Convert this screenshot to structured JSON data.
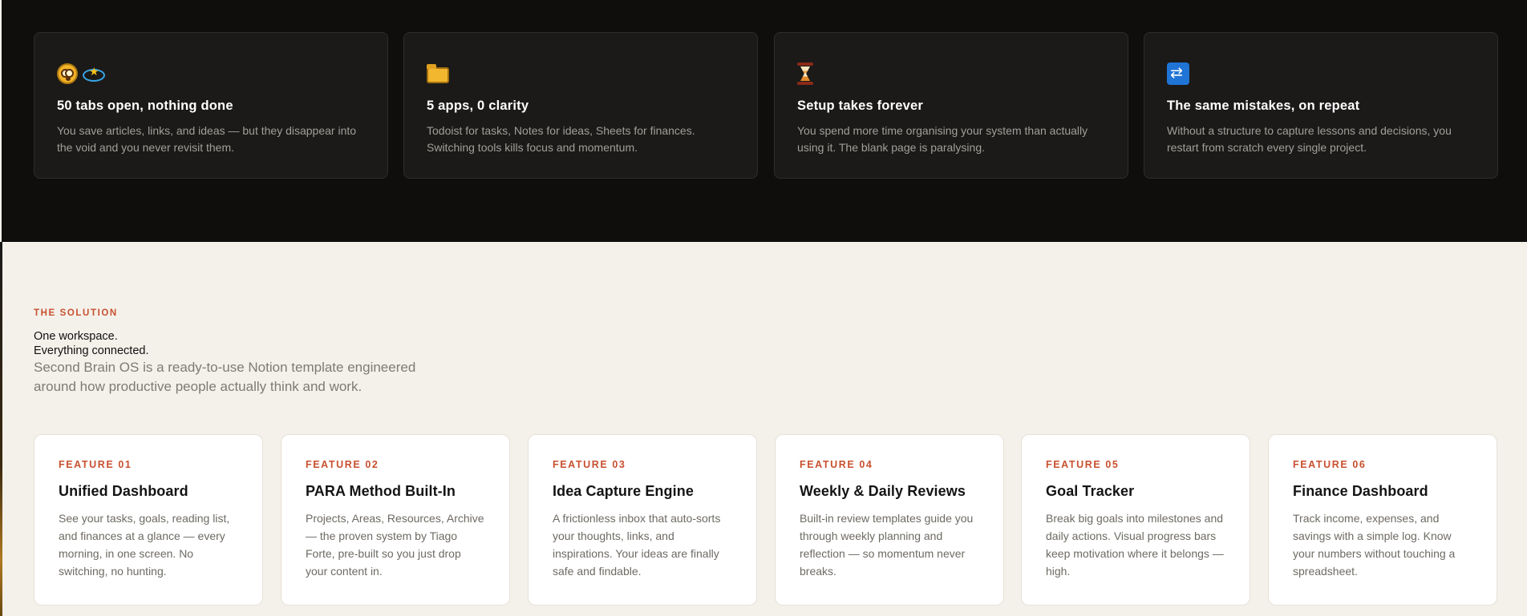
{
  "problems": [
    {
      "icons": [
        "face-with-spiral-eyes-icon",
        "dizzy-icon"
      ],
      "title": "50 tabs open, nothing done",
      "description": "You save articles, links, and ideas — but they disappear into the void and you never revisit them."
    },
    {
      "icons": [
        "folder-icon"
      ],
      "title": "5 apps, 0 clarity",
      "description": "Todoist for tasks, Notes for ideas, Sheets for finances. Switching tools kills focus and momentum."
    },
    {
      "icons": [
        "hourglass-icon"
      ],
      "title": "Setup takes forever",
      "description": "You spend more time organising your system than actually using it. The blank page is paralysing."
    },
    {
      "icons": [
        "repeat-icon"
      ],
      "title": "The same mistakes, on repeat",
      "description": "Without a structure to capture lessons and decisions, you restart from scratch every single project."
    }
  ],
  "solution": {
    "label": "THE SOLUTION",
    "headline_line1": "One workspace.",
    "headline_line2": "Everything connected.",
    "subheadline": "Second Brain OS is a ready-to-use Notion template engineered around how productive people actually think and work."
  },
  "features": [
    {
      "number": "FEATURE 01",
      "title": "Unified Dashboard",
      "description": "See your tasks, goals, reading list, and finances at a glance — every morning, in one screen. No switching, no hunting."
    },
    {
      "number": "FEATURE 02",
      "title": "PARA Method Built-In",
      "description": "Projects, Areas, Resources, Archive — the proven system by Tiago Forte, pre-built so you just drop your content in."
    },
    {
      "number": "FEATURE 03",
      "title": "Idea Capture Engine",
      "description": "A frictionless inbox that auto-sorts your thoughts, links, and inspirations. Your ideas are finally safe and findable."
    },
    {
      "number": "FEATURE 04",
      "title": "Weekly & Daily Reviews",
      "description": "Built-in review templates guide you through weekly planning and reflection — so momentum never breaks."
    },
    {
      "number": "FEATURE 05",
      "title": "Goal Tracker",
      "description": "Break big goals into milestones and daily actions. Visual progress bars keep motivation where it belongs — high."
    },
    {
      "number": "FEATURE 06",
      "title": "Finance Dashboard",
      "description": "Track income, expenses, and savings with a simple log. Know your numbers without touching a spreadsheet."
    }
  ],
  "colors": {
    "accent": "#c8502f",
    "dark_bg": "#0f0e0d",
    "card_dark": "#1b1a19",
    "light_bg": "#f4f1ea"
  }
}
